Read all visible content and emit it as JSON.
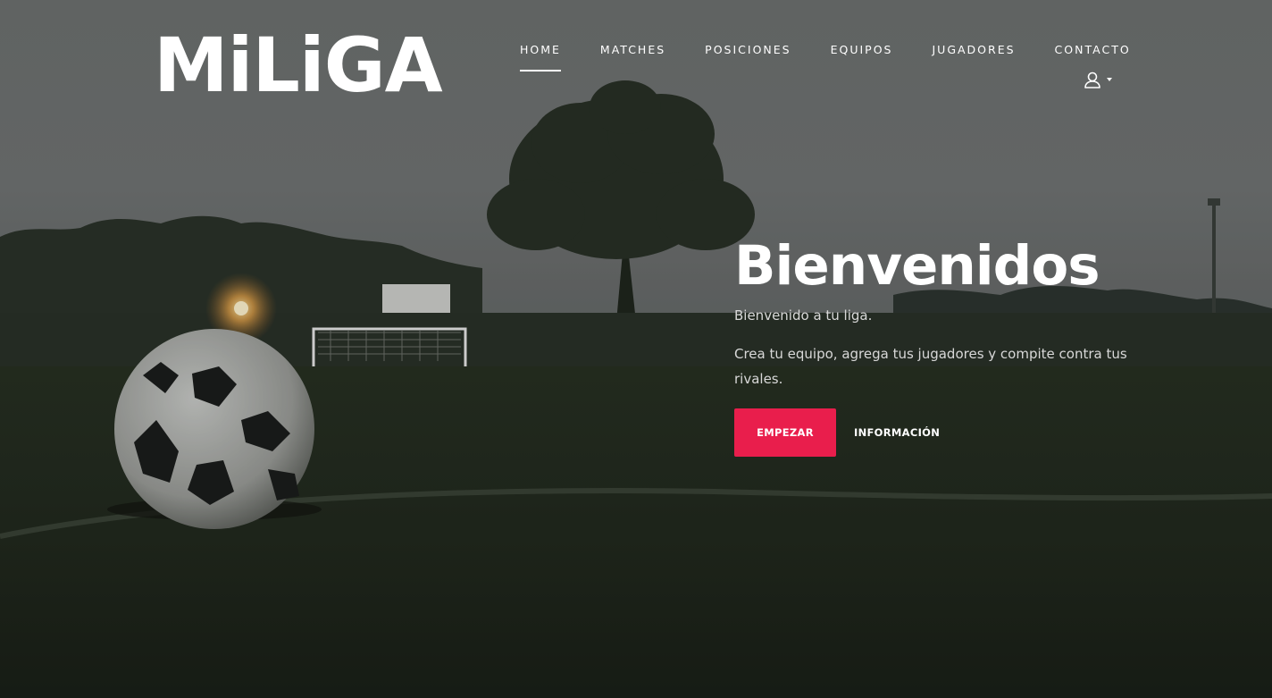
{
  "brand": {
    "logo_text": "MiLiGA"
  },
  "nav": {
    "items": [
      {
        "label": "HOME",
        "active": true
      },
      {
        "label": "MATCHES",
        "active": false
      },
      {
        "label": "POSICIONES",
        "active": false
      },
      {
        "label": "EQUIPOS",
        "active": false
      },
      {
        "label": "JUGADORES",
        "active": false
      },
      {
        "label": "CONTACTO",
        "active": false
      }
    ],
    "user_icon": "user-icon"
  },
  "hero": {
    "title": "Bienvenidos",
    "subtitle": "Bienvenido a tu liga.",
    "description": "Crea tu equipo, agrega tus jugadores y compite contra tus rivales.",
    "primary_button": "EMPEZAR",
    "secondary_link": "INFORMACIÓN",
    "background": "soccer-ball-on-field-photo"
  },
  "colors": {
    "accent": "#e91e4c",
    "text": "#ffffff",
    "overlay": "#6e7270"
  }
}
